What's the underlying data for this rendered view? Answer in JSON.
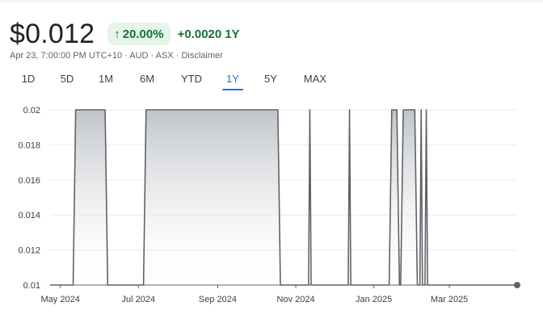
{
  "quote": {
    "price": "$0.012",
    "arrow": "↑",
    "percent_change": "20.00%",
    "abs_change": "+0.0020",
    "period": "1Y",
    "subline": "Apr 23, 7:00:00 PM UTC+10 · AUD · ASX · Disclaimer"
  },
  "tabs": [
    {
      "label": "1D"
    },
    {
      "label": "5D"
    },
    {
      "label": "1M"
    },
    {
      "label": "6M"
    },
    {
      "label": "YTD"
    },
    {
      "label": "1Y",
      "active": true
    },
    {
      "label": "5Y"
    },
    {
      "label": "MAX"
    }
  ],
  "colors": {
    "positive": "#137333",
    "positive_bg": "#e6f4ea",
    "accent": "#1a73e8",
    "line": "#5f6368"
  },
  "chart_data": {
    "type": "area",
    "ylim": [
      0.01,
      0.02
    ],
    "y_ticks": [
      "0.02",
      "0.018",
      "0.016",
      "0.014",
      "0.012",
      "0.01"
    ],
    "x_ticks": [
      {
        "label": "May 2024",
        "date": "2024-05-01"
      },
      {
        "label": "Jul 2024",
        "date": "2024-07-01"
      },
      {
        "label": "Sep 2024",
        "date": "2024-09-01"
      },
      {
        "label": "Nov 2024",
        "date": "2024-11-01"
      },
      {
        "label": "Jan 2025",
        "date": "2025-01-01"
      },
      {
        "label": "Mar 2025",
        "date": "2025-03-01"
      }
    ],
    "series": [
      {
        "points": [
          [
            "2024-04-23",
            0.01
          ],
          [
            "2024-05-11",
            0.01
          ],
          [
            "2024-05-13",
            0.02
          ],
          [
            "2024-06-05",
            0.02
          ],
          [
            "2024-06-07",
            0.01
          ],
          [
            "2024-07-05",
            0.01
          ],
          [
            "2024-07-07",
            0.02
          ],
          [
            "2024-10-18",
            0.02
          ],
          [
            "2024-10-20",
            0.01
          ],
          [
            "2024-11-11",
            0.01
          ],
          [
            "2024-11-12",
            0.02
          ],
          [
            "2024-11-13",
            0.01
          ],
          [
            "2024-12-12",
            0.01
          ],
          [
            "2024-12-13",
            0.02
          ],
          [
            "2024-12-14",
            0.01
          ],
          [
            "2025-01-13",
            0.01
          ],
          [
            "2025-01-15",
            0.02
          ],
          [
            "2025-01-19",
            0.02
          ],
          [
            "2025-01-21",
            0.01
          ],
          [
            "2025-01-22",
            0.01
          ],
          [
            "2025-01-24",
            0.02
          ],
          [
            "2025-02-02",
            0.02
          ],
          [
            "2025-02-04",
            0.01
          ],
          [
            "2025-02-06",
            0.01
          ],
          [
            "2025-02-07",
            0.02
          ],
          [
            "2025-02-08",
            0.01
          ],
          [
            "2025-02-10",
            0.01
          ],
          [
            "2025-02-11",
            0.02
          ],
          [
            "2025-02-12",
            0.01
          ],
          [
            "2025-04-23",
            0.01
          ]
        ]
      }
    ],
    "grid": true,
    "end_marker": true
  }
}
